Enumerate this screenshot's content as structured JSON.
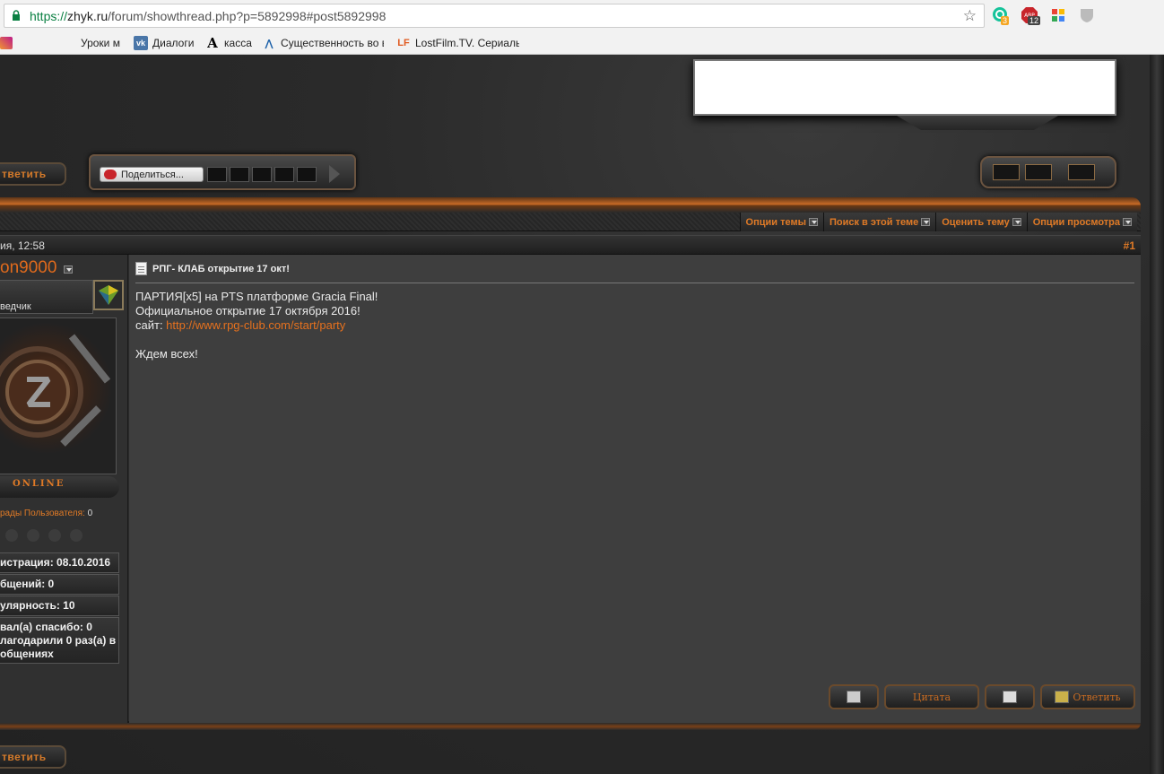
{
  "browser": {
    "url_scheme": "https://",
    "url_host": "zhyk.ru",
    "url_path": "/forum/showthread.php?p=5892998#post5892998",
    "extensions": [
      {
        "name": "grammarly-icon",
        "badge": "3",
        "badge_color": "#f5a623"
      },
      {
        "name": "adblock-icon",
        "badge": "12",
        "badge_color": "#444"
      },
      {
        "name": "pinwheel-icon",
        "badge": ""
      },
      {
        "name": "shield-icon",
        "badge": ""
      }
    ],
    "bookmarks": [
      {
        "label": "Уроки м",
        "icon": ""
      },
      {
        "label": "Диалоги",
        "icon": "vk"
      },
      {
        "label": "касса",
        "icon": "A"
      },
      {
        "label": "Существенность во в",
        "icon": "bird"
      },
      {
        "label": "LostFilm.TV. Сериалы",
        "icon": "LF"
      }
    ]
  },
  "forum": {
    "reply_label": "тветить",
    "share_label": "Поделиться...",
    "thread_tools": [
      {
        "label": "Опции темы"
      },
      {
        "label": "Поиск в этой теме"
      },
      {
        "label": "Оценить тему"
      },
      {
        "label": "Опции просмотра"
      }
    ],
    "post": {
      "date": "ия, 12:58",
      "number": "#1",
      "author": "on9000",
      "rank": "ведчик",
      "online": "ONLINE",
      "awards_label": "рады Пользователя:",
      "awards_count": "0",
      "stats": [
        "истрация: 08.10.2016",
        "бщений: 0",
        "улярность: 10",
        "вал(а) спасибо: 0",
        "лагодарили 0 раз(а) в",
        "общениях"
      ],
      "title": "РПГ- КЛАБ открытие 17 окт!",
      "lines": [
        "ПАРТИЯ[x5] на PTS платформе Gracia Final!",
        "Официальное открытие 17 октября 2016!",
        "сайт: "
      ],
      "link": "http://www.rpg-club.com/start/party",
      "closing": "Ждем всех!",
      "actions": {
        "quote": "Цитата",
        "reply": "Ответить"
      }
    }
  },
  "colors": {
    "accent": "#e07a26",
    "link": "#e6711e"
  }
}
